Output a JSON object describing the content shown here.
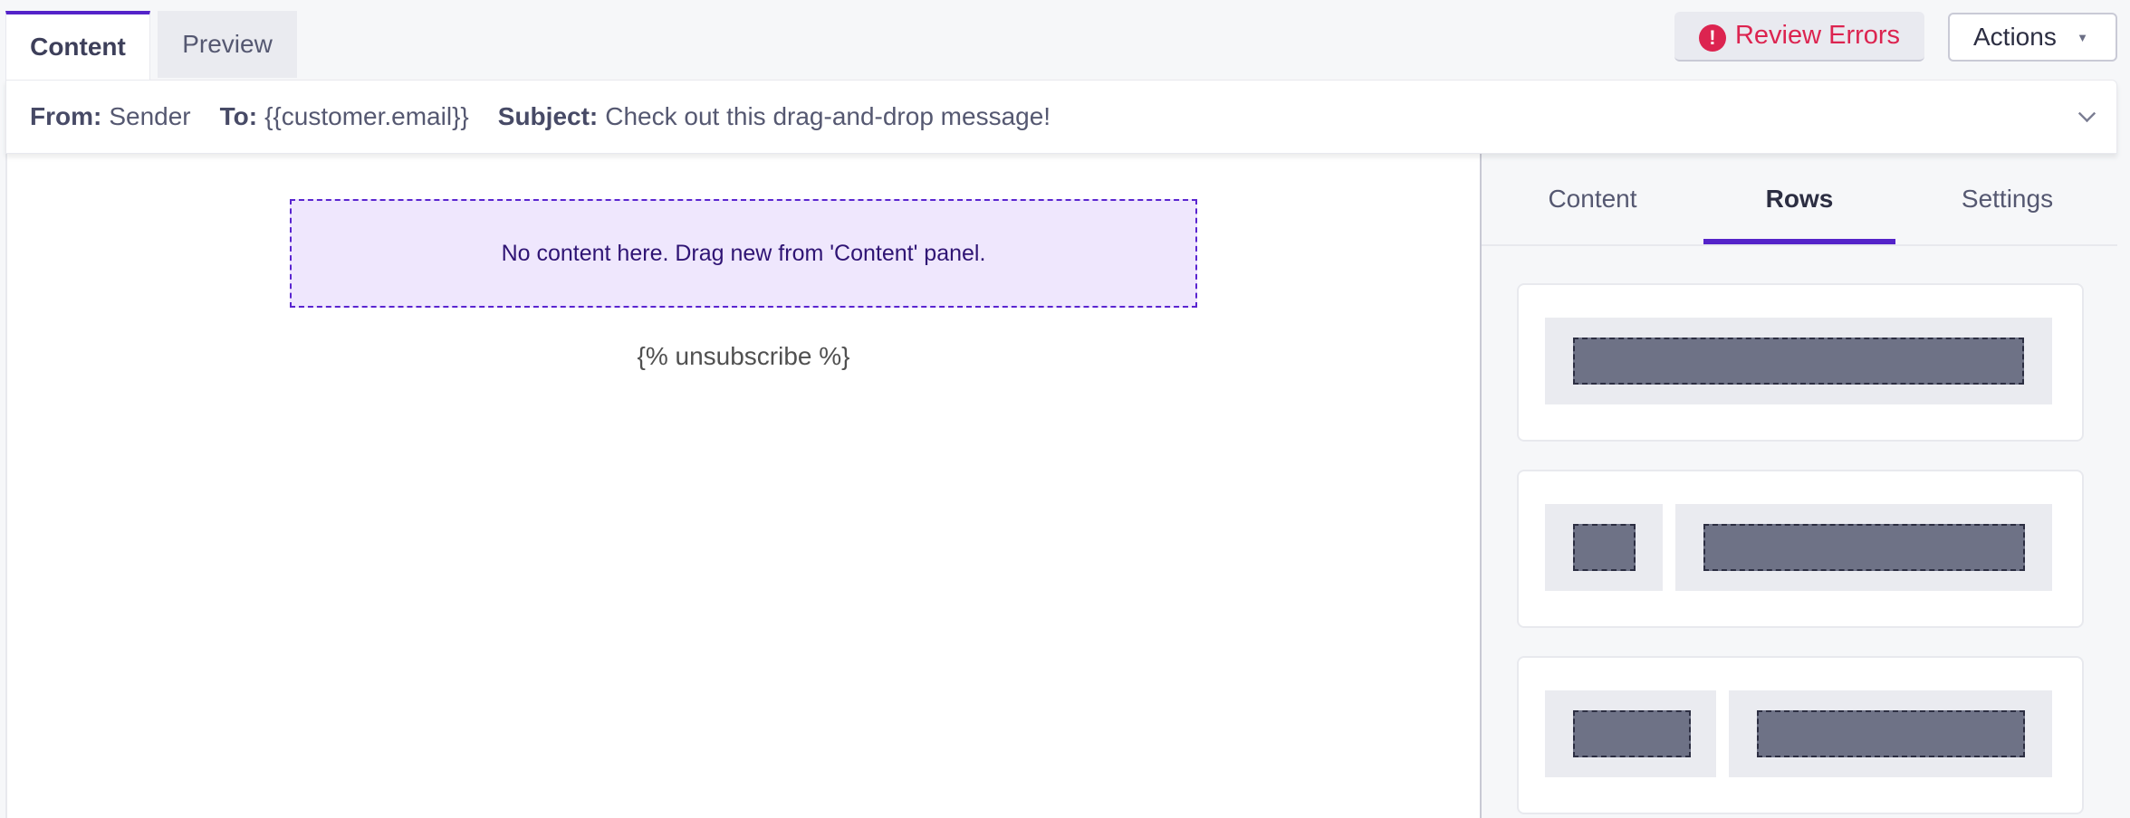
{
  "editor_tabs": [
    {
      "label": "Content",
      "active": true
    },
    {
      "label": "Preview",
      "active": false
    }
  ],
  "toolbar": {
    "review_errors_label": "Review Errors",
    "review_errors_icon": "!",
    "actions_label": "Actions",
    "actions_caret": "▼"
  },
  "mail_header": {
    "from_label": "From:",
    "from_value": "Sender",
    "to_label": "To:",
    "to_value": "{{customer.email}}",
    "subject_label": "Subject:",
    "subject_value": "Check out this drag-and-drop message!"
  },
  "canvas": {
    "empty_dropzone_text": "No content here. Drag new from 'Content' panel.",
    "unsubscribe_text": "{% unsubscribe %}"
  },
  "side_panel": {
    "tabs": [
      {
        "label": "Content",
        "active": false
      },
      {
        "label": "Rows",
        "active": true
      },
      {
        "label": "Settings",
        "active": false
      }
    ],
    "row_layouts": [
      {
        "name": "one-column",
        "columns": 1
      },
      {
        "name": "two-column-1-3",
        "columns": 2
      },
      {
        "name": "two-column-1-2",
        "columns": 2
      }
    ]
  },
  "colors": {
    "accent": "#5423c9",
    "error": "#dc2450",
    "dropzone_bg": "#efe7fd"
  }
}
